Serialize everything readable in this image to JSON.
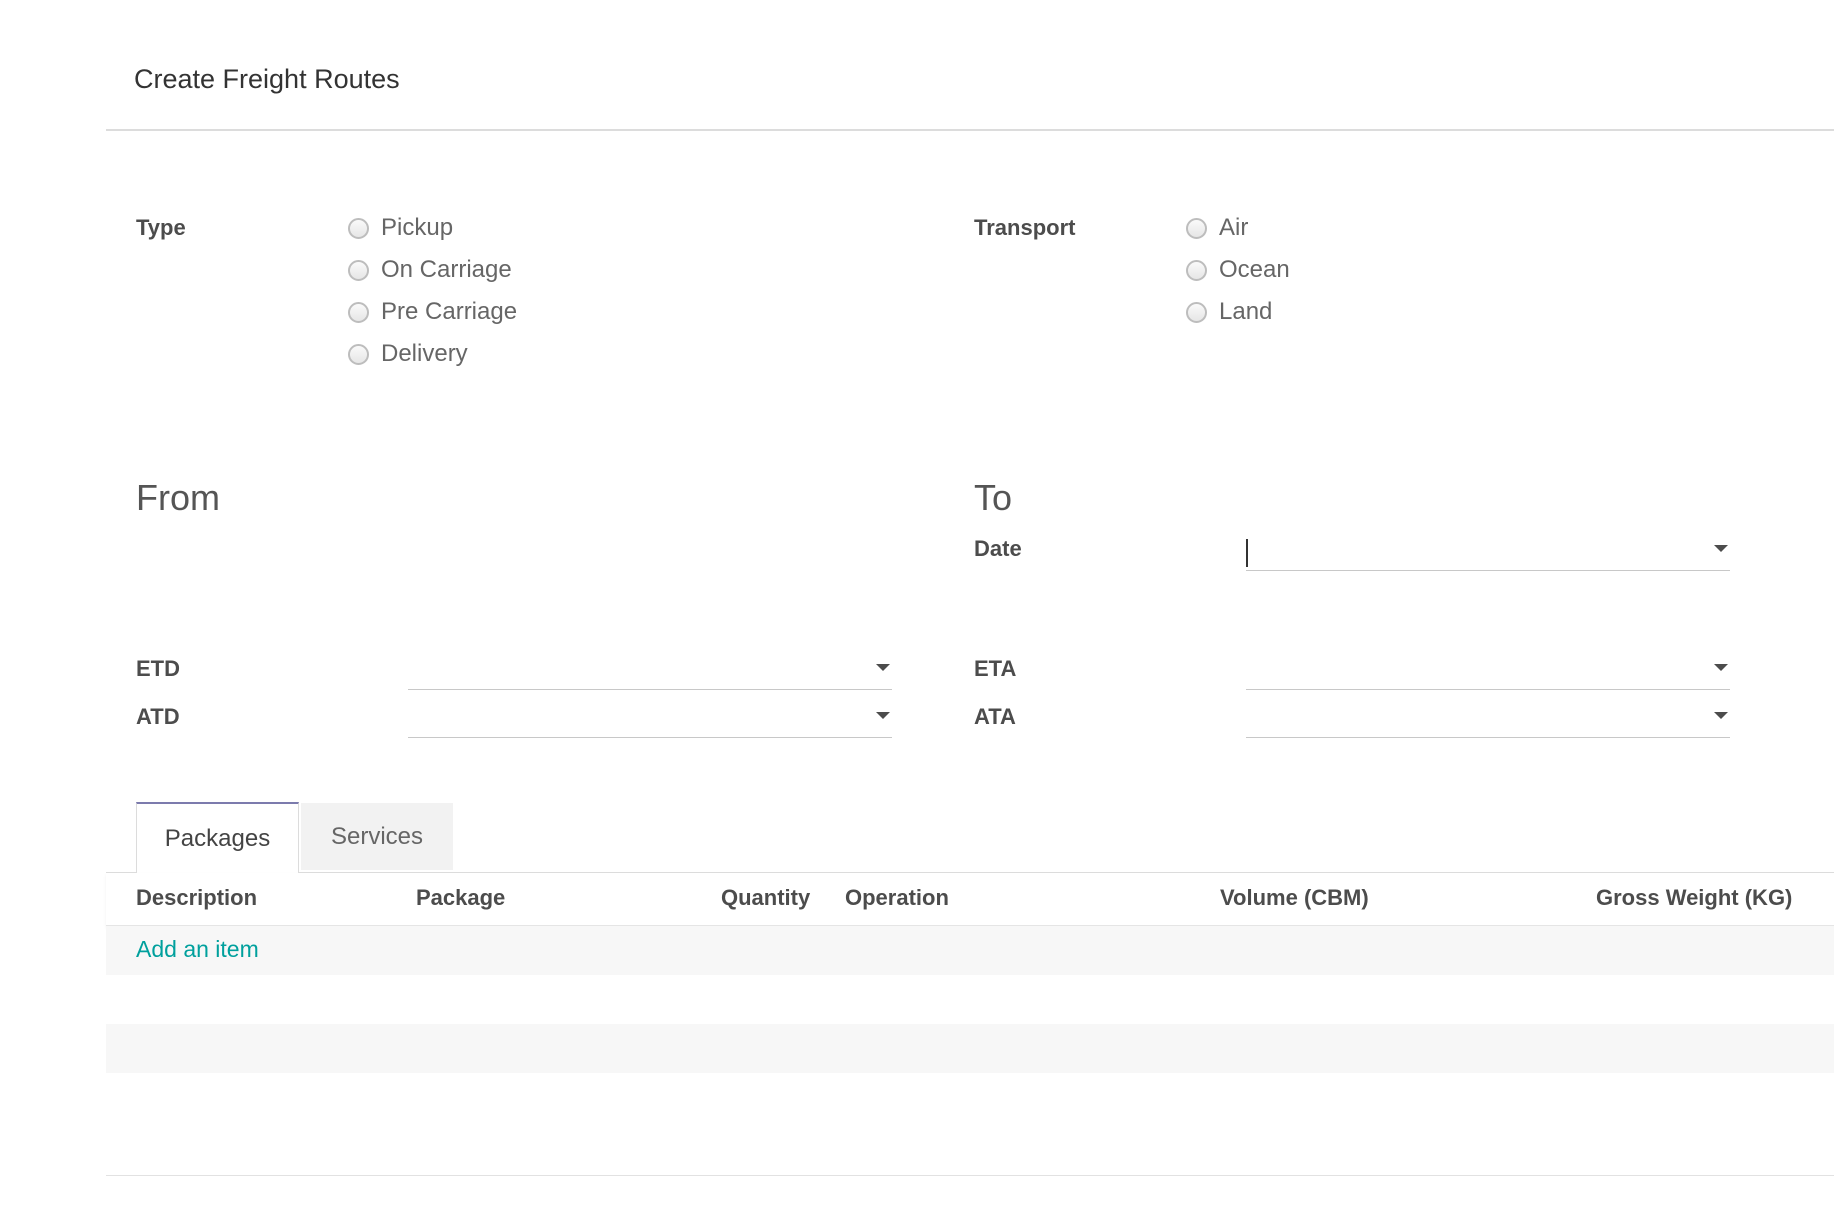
{
  "dialog": {
    "title": "Create Freight Routes",
    "close_icon": "close-icon"
  },
  "type_field": {
    "label": "Type",
    "options": [
      "Pickup",
      "On Carriage",
      "Pre Carriage",
      "Delivery"
    ],
    "selected": null
  },
  "transport_field": {
    "label": "Transport",
    "options": [
      "Air",
      "Ocean",
      "Land"
    ],
    "selected": null
  },
  "from_section": {
    "heading": "From",
    "etd_label": "ETD",
    "etd_value": "",
    "atd_label": "ATD",
    "atd_value": ""
  },
  "to_section": {
    "heading": "To",
    "date_label": "Date",
    "date_value": "",
    "eta_label": "ETA",
    "eta_value": "",
    "ata_label": "ATA",
    "ata_value": ""
  },
  "tabs": [
    {
      "label": "Packages",
      "active": true
    },
    {
      "label": "Services",
      "active": false
    }
  ],
  "packages_table": {
    "columns": [
      "Description",
      "Package",
      "Quantity",
      "Operation",
      "Volume (CBM)",
      "Gross Weight (KG)"
    ],
    "rows": [],
    "add_item_label": "Add an item"
  },
  "colors": {
    "accent_link": "#00a09d",
    "active_tab_border": "#7c7bad",
    "label_text": "#4c4c4c"
  }
}
